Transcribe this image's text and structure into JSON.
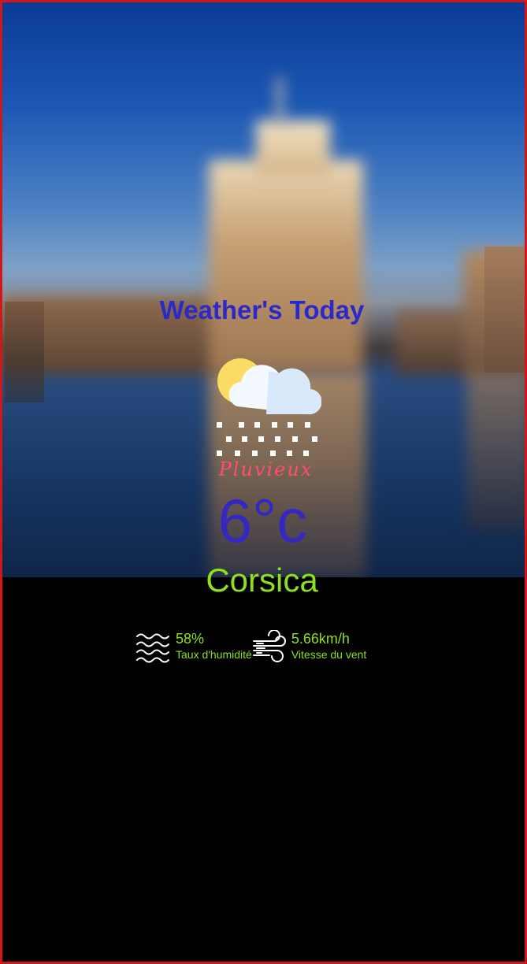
{
  "app": {
    "title": "Weather's Today"
  },
  "weather": {
    "icon": "cloud-sun-rain-icon",
    "condition": "Pluvieux",
    "temperature": "6°c",
    "city": "Corsica"
  },
  "details": {
    "humidity": {
      "icon": "humidity-waves-icon",
      "value": "58%",
      "label": "Taux d'humidité"
    },
    "wind": {
      "icon": "wind-icon",
      "value": "5.66km/h",
      "label": "Vitesse du vent"
    }
  },
  "colors": {
    "border": "#d01818",
    "title": "#2b2ac8",
    "condition": "#ff4f6e",
    "temperature": "#3427c2",
    "accent_green": "#8fe01a",
    "background": "#000000"
  }
}
